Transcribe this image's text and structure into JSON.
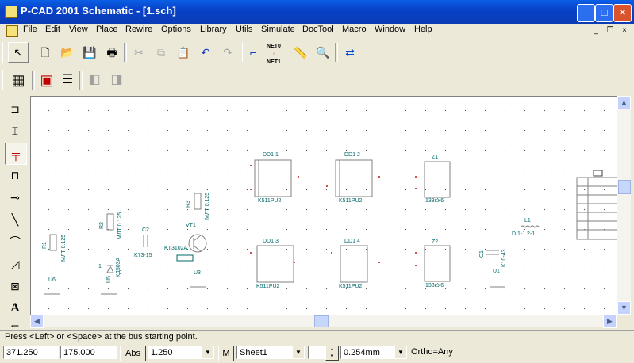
{
  "window": {
    "title": "P-CAD 2001 Schematic - [1.sch]",
    "min": "_",
    "max": "□",
    "close": "×"
  },
  "menu": [
    "File",
    "Edit",
    "View",
    "Place",
    "Rewire",
    "Options",
    "Library",
    "Utils",
    "Simulate",
    "DocTool",
    "Macro",
    "Window",
    "Help"
  ],
  "mdi": {
    "min": "_",
    "restore": "❐",
    "close": "×"
  },
  "toolbar": {
    "net_icon_top": "NET0",
    "net_icon_bottom": "NET1"
  },
  "components": {
    "dd1": {
      "ref": "DD1 1",
      "value": "K511PU2"
    },
    "dd2": {
      "ref": "DD1 2",
      "value": "K511PU2"
    },
    "dd3": {
      "ref": "DD1 3",
      "value": "K511PU2"
    },
    "dd4": {
      "ref": "DD1 4",
      "value": "K511PU2"
    },
    "z1": {
      "ref": "Z1",
      "value": "133кУ6"
    },
    "z2": {
      "ref": "Z2",
      "value": "133кУ6"
    },
    "r1": {
      "ref": "R1",
      "value": "МЛТ 0.125"
    },
    "r2": {
      "ref": "R2",
      "value": "МЛТ 0.125"
    },
    "r3": {
      "ref": "R3",
      "value": "МЛТ 0.125"
    },
    "c1": {
      "ref": "C1",
      "value": "K10-43"
    },
    "c2": {
      "ref": "C2",
      "value": "K73-15"
    },
    "vt1": {
      "ref": "VT1",
      "value": "KT3102А"
    },
    "vd": {
      "ref": "1",
      "value": "КД503А"
    },
    "l1": {
      "ref": "L1",
      "value": "D 1-1.2-1"
    },
    "u1": {
      "ref": "U1"
    },
    "u3": {
      "ref": "U3"
    },
    "u5": {
      "ref": "U5"
    },
    "u6": {
      "ref": "U6"
    }
  },
  "status": {
    "message": "Press <Left> or <Space> at the bus starting point.",
    "x": "371.250",
    "y": "175.000",
    "abs": "Abs",
    "grid": "1.250",
    "m": "M",
    "sheet": "Sheet1",
    "width": "0.254mm",
    "ortho": "Ortho=Any"
  }
}
